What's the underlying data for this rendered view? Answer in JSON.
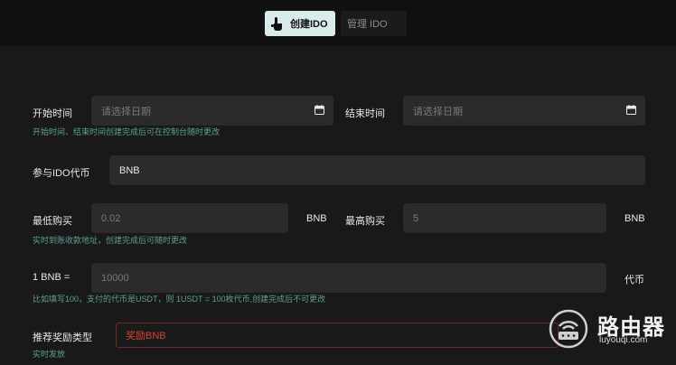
{
  "tabs": [
    {
      "label": "创建IDO",
      "active": true
    },
    {
      "label": "管理 IDO",
      "active": false
    }
  ],
  "form": {
    "start_time": {
      "label": "开始时间",
      "placeholder": "请选择日期"
    },
    "end_time": {
      "label": "结束时间",
      "placeholder": "请选择日期"
    },
    "time_hint": "开始时间、结束时间创建完成后可在控制台随时更改",
    "token": {
      "label": "参与IDO代币",
      "value": "BNB"
    },
    "min_buy": {
      "label": "最低购买",
      "placeholder": "0.02",
      "unit": "BNB"
    },
    "max_buy": {
      "label": "最高购买",
      "placeholder": "5",
      "unit": "BNB"
    },
    "buy_hint": "实时到账收款地址，创建完成后可随时更改",
    "rate": {
      "label": "1 BNB =",
      "placeholder": "10000",
      "unit": "代币"
    },
    "rate_hint": "比如填写100，支付的代币是USDT，则 1USDT = 100枚代币,创建完成后不可更改",
    "reward_type": {
      "label": "推荐奖励类型",
      "value": "奖励BNB"
    },
    "reward_hint": "实时发放"
  },
  "watermark": {
    "name": "路由器",
    "domain": "luyouqi.com"
  },
  "colors": {
    "accent_tab_bg": "#d9ecea",
    "hint": "#5e9f96",
    "error_border": "#6a2b22",
    "error_text": "#d5442f"
  }
}
